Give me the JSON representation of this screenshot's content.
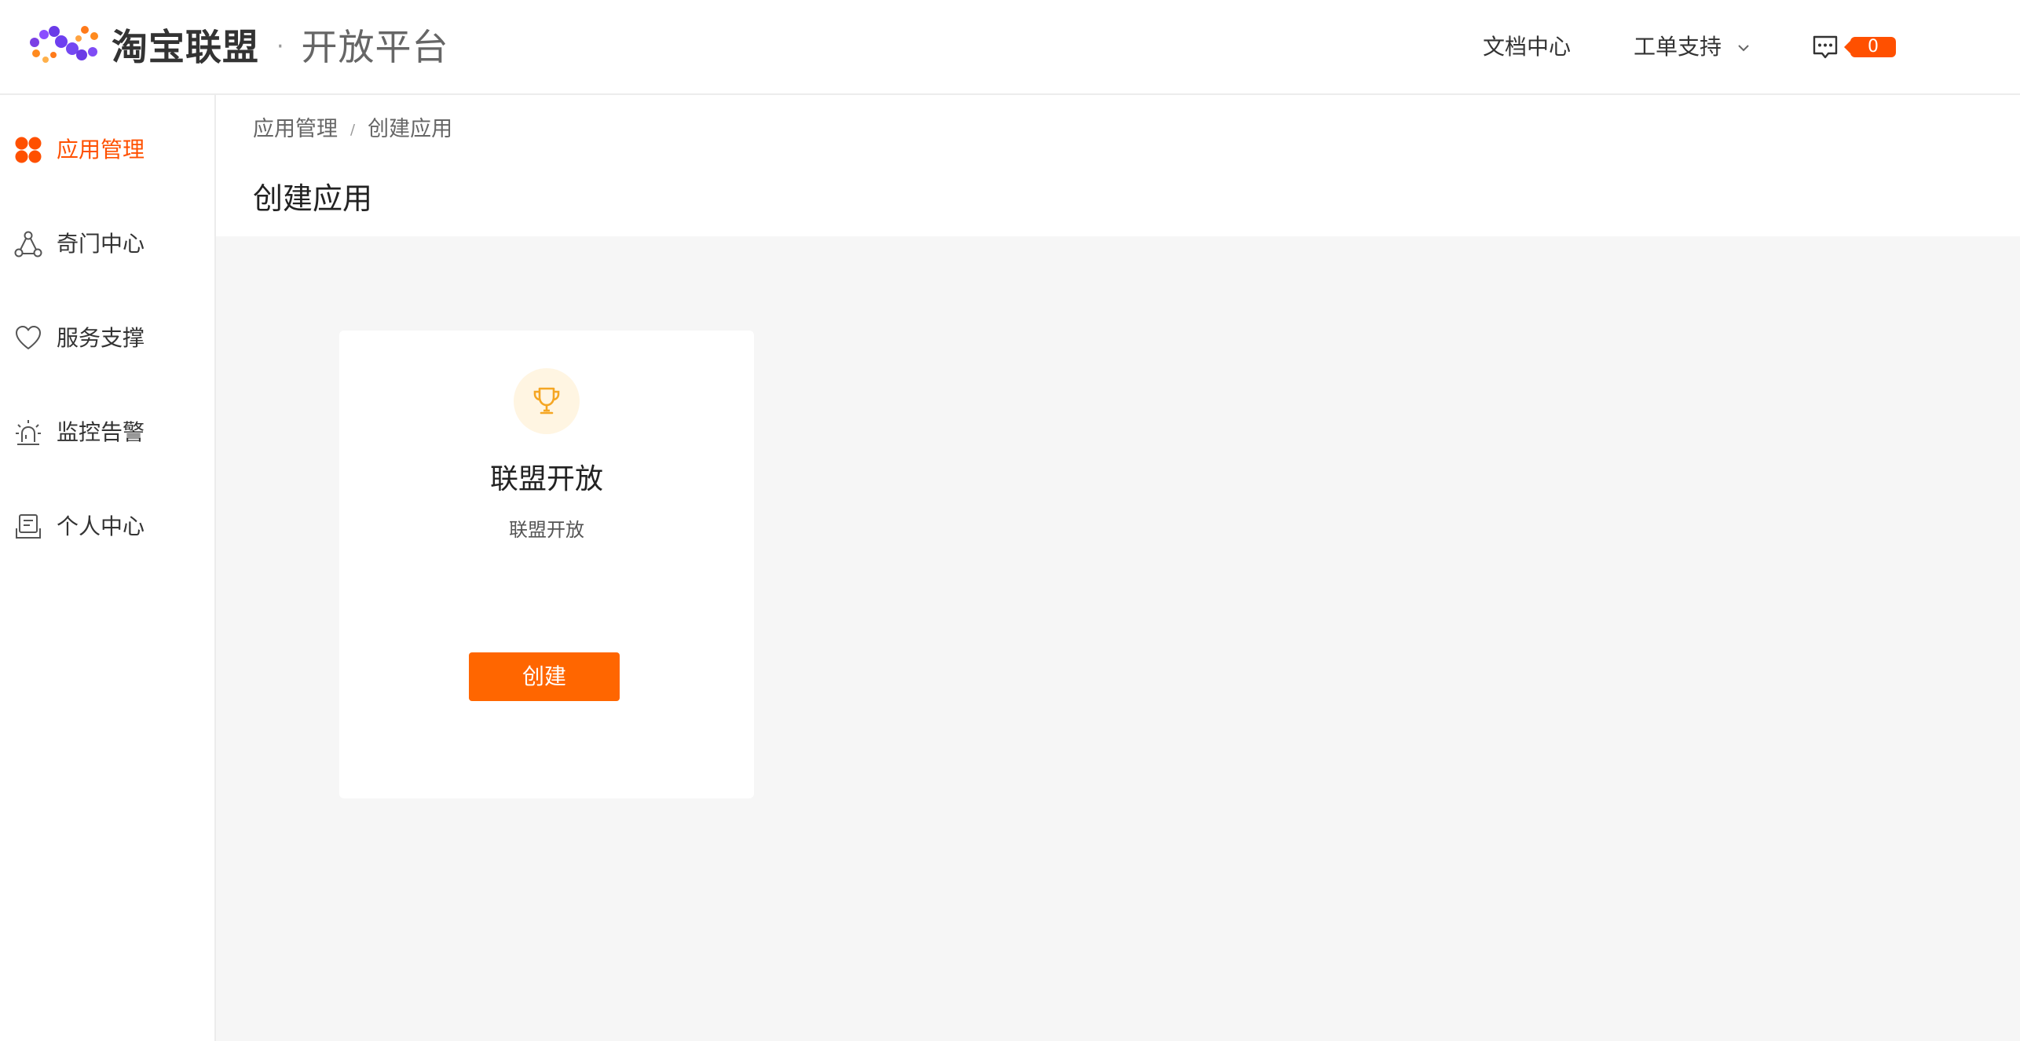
{
  "header": {
    "brand_name": "淘宝联盟",
    "brand_dot": "·",
    "brand_sub": "开放平台",
    "nav": [
      {
        "label": "文档中心"
      },
      {
        "label": "工单支持"
      }
    ],
    "message_count": "0"
  },
  "sidebar": {
    "items": [
      {
        "label": "应用管理",
        "icon": "grid-icon",
        "active": true
      },
      {
        "label": "奇门中心",
        "icon": "network-icon",
        "active": false
      },
      {
        "label": "服务支撑",
        "icon": "heart-icon",
        "active": false
      },
      {
        "label": "监控告警",
        "icon": "alarm-icon",
        "active": false
      },
      {
        "label": "个人中心",
        "icon": "profile-icon",
        "active": false
      }
    ]
  },
  "breadcrumb": {
    "items": [
      "应用管理",
      "创建应用"
    ],
    "separator": "/"
  },
  "page": {
    "title": "创建应用"
  },
  "card": {
    "icon": "trophy-icon",
    "title": "联盟开放",
    "description": "联盟开放",
    "button_label": "创建"
  },
  "colors": {
    "accent": "#ff5000",
    "button": "#ff6600",
    "trophy": "#f5a623",
    "trophy_bg": "#fff5e2",
    "content_bg": "#f6f6f6"
  }
}
